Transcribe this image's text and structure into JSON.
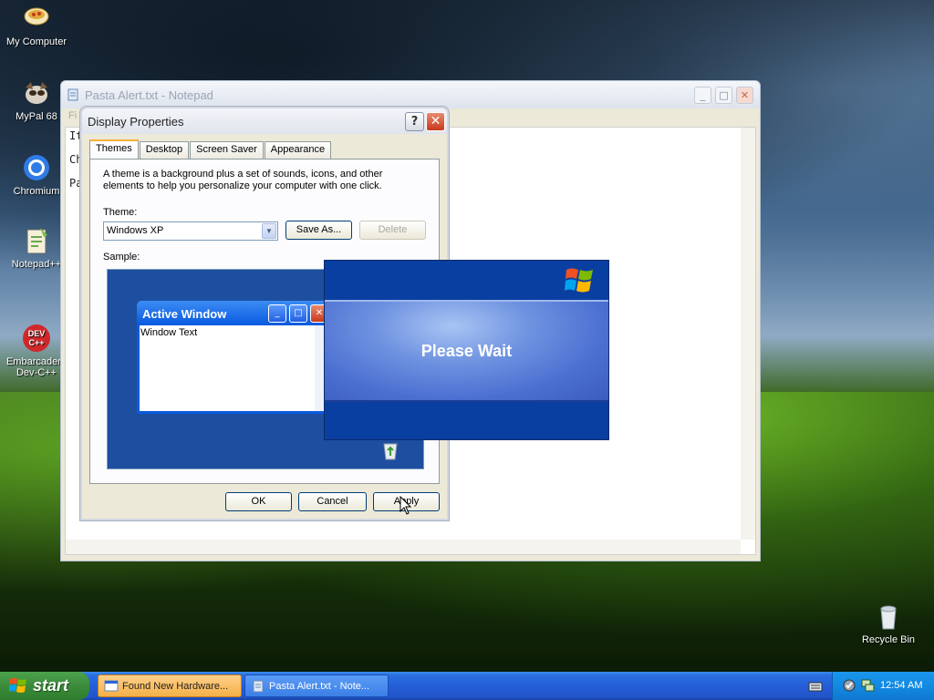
{
  "desktop": {
    "icons": [
      {
        "label": "My Computer",
        "icon": "computer-icon"
      },
      {
        "label": "MyPal 68",
        "icon": "mypal-icon"
      },
      {
        "label": "Chromium",
        "icon": "chromium-icon"
      },
      {
        "label": "Notepad++",
        "icon": "notepadpp-icon"
      },
      {
        "label": "Embarcadero\nDev-C++",
        "icon": "devcpp-icon"
      },
      {
        "label": "Recycle Bin",
        "icon": "recycle-bin-icon"
      }
    ]
  },
  "notepad": {
    "title": "Pasta Alert.txt - Notepad",
    "menu_partial": "Fi",
    "lines": [
      "It",
      "Ch",
      "Pa"
    ]
  },
  "display_properties": {
    "title": "Display Properties",
    "help": "?",
    "close": "✕",
    "tabs": [
      "Themes",
      "Desktop",
      "Screen Saver",
      "Appearance"
    ],
    "active_tab": "Themes",
    "description": "A theme is a background plus a set of sounds, icons, and other elements to help you personalize your computer with one click.",
    "theme_label": "Theme:",
    "theme_value": "Windows XP",
    "save_as": "Save As...",
    "delete": "Delete",
    "sample_label": "Sample:",
    "sample": {
      "active_window_title": "Active Window",
      "window_text": "Window Text"
    },
    "ok": "OK",
    "cancel": "Cancel",
    "apply": "Apply"
  },
  "please_wait": {
    "text": "Please Wait"
  },
  "taskbar": {
    "start": "start",
    "tasks": [
      {
        "label": "Found New Hardware...",
        "active": true
      },
      {
        "label": "Pasta Alert.txt - Note...",
        "active": false
      }
    ],
    "clock": "12:54 AM"
  },
  "colors": {
    "xp_blue": "#245ed8",
    "start_green": "#3b8b3b",
    "active_title": "#0a5be0",
    "close_red": "#c8391b"
  }
}
